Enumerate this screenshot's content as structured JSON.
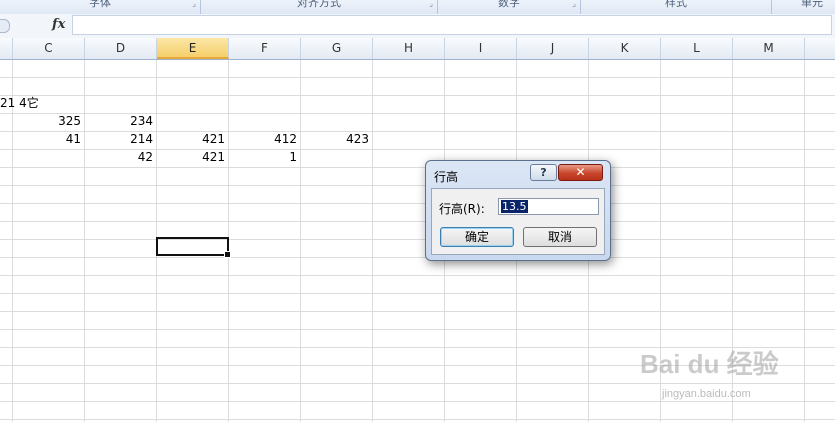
{
  "ribbon": {
    "groups": [
      "字体",
      "对齐方式",
      "数字",
      "样式",
      "单元"
    ]
  },
  "formula_bar": {
    "fx_label": "fx",
    "value": ""
  },
  "columns": [
    "C",
    "D",
    "E",
    "F",
    "G",
    "H",
    "I",
    "J",
    "K",
    "L",
    "M"
  ],
  "selected_column": "E",
  "cells": {
    "row4_partial": "21 4它",
    "c5": "325",
    "d5": "234",
    "c6": "41",
    "d6": "214",
    "e6": "421",
    "f6": "412",
    "g6": "423",
    "d7": "42",
    "e7": "421",
    "f7": "1"
  },
  "dialog": {
    "title": "行高",
    "help_label": "?",
    "close_label": "✕",
    "field_label": "行高(R):",
    "field_value": "13.5",
    "ok_label": "确定",
    "cancel_label": "取消"
  },
  "watermark": {
    "logo": "Bai du 经验",
    "url": "jingyan.baidu.com"
  }
}
